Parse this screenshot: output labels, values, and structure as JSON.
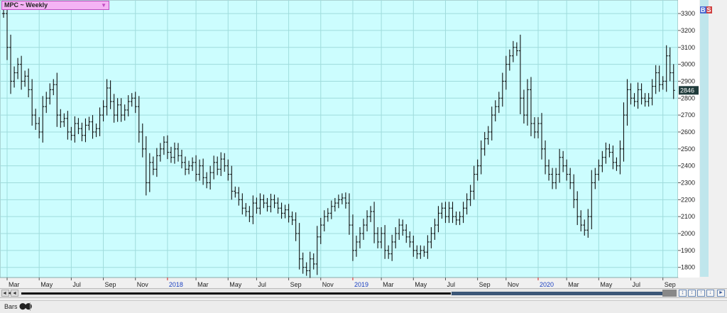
{
  "window": {
    "symbol_title": "MPC ~ Weekly",
    "bs_b": "B",
    "bs_s": "S"
  },
  "statusbar": {
    "view_label": "Bars"
  },
  "chart_data": {
    "type": "ohlc",
    "title": "MPC ~ Weekly",
    "ylim": [
      1740,
      3380
    ],
    "yticks": [
      1800,
      1900,
      2000,
      2100,
      2200,
      2300,
      2400,
      2500,
      2600,
      2700,
      2800,
      2900,
      3000,
      3100,
      3200,
      3300
    ],
    "last_price_label": "2846",
    "x_ticks": [
      {
        "label": "Mar",
        "week": 1,
        "year": false
      },
      {
        "label": "May",
        "week": 10,
        "year": false
      },
      {
        "label": "Jul",
        "week": 19,
        "year": false
      },
      {
        "label": "Sep",
        "week": 28,
        "year": false
      },
      {
        "label": "Nov",
        "week": 37,
        "year": false
      },
      {
        "label": "2018",
        "week": 46,
        "year": true
      },
      {
        "label": "Mar",
        "week": 54,
        "year": false
      },
      {
        "label": "May",
        "week": 63,
        "year": false
      },
      {
        "label": "Jul",
        "week": 71,
        "year": false
      },
      {
        "label": "Sep",
        "week": 80,
        "year": false
      },
      {
        "label": "Nov",
        "week": 89,
        "year": false
      },
      {
        "label": "2019",
        "week": 98,
        "year": true
      },
      {
        "label": "Mar",
        "week": 106,
        "year": false
      },
      {
        "label": "May",
        "week": 115,
        "year": false
      },
      {
        "label": "Jul",
        "week": 124,
        "year": false
      },
      {
        "label": "Sep",
        "week": 133,
        "year": false
      },
      {
        "label": "Nov",
        "week": 141,
        "year": false
      },
      {
        "label": "2020",
        "week": 150,
        "year": true
      },
      {
        "label": "Mar",
        "week": 158,
        "year": false
      },
      {
        "label": "May",
        "week": 167,
        "year": false
      },
      {
        "label": "Jul",
        "week": 176,
        "year": false
      },
      {
        "label": "Sep",
        "week": 185,
        "year": false
      }
    ],
    "closes": [
      3300,
      3100,
      2900,
      2950,
      3000,
      2900,
      2930,
      2850,
      2700,
      2650,
      2600,
      2750,
      2800,
      2850,
      2880,
      2700,
      2660,
      2680,
      2600,
      2580,
      2650,
      2620,
      2580,
      2640,
      2660,
      2600,
      2620,
      2700,
      2750,
      2860,
      2780,
      2700,
      2760,
      2700,
      2730,
      2780,
      2800,
      2750,
      2600,
      2500,
      2300,
      2420,
      2380,
      2460,
      2500,
      2540,
      2480,
      2450,
      2500,
      2460,
      2420,
      2380,
      2400,
      2420,
      2350,
      2400,
      2330,
      2300,
      2360,
      2420,
      2380,
      2440,
      2400,
      2350,
      2250,
      2240,
      2200,
      2150,
      2130,
      2100,
      2180,
      2150,
      2200,
      2180,
      2160,
      2200,
      2180,
      2150,
      2120,
      2140,
      2100,
      2080,
      2000,
      1850,
      1800,
      1780,
      1850,
      1820,
      1980,
      2050,
      2100,
      2120,
      2160,
      2180,
      2200,
      2210,
      2180,
      2050,
      1900,
      1950,
      2000,
      2050,
      2100,
      2130,
      2000,
      1950,
      2000,
      1900,
      1880,
      1950,
      2000,
      2050,
      2020,
      1980,
      1950,
      1900,
      1880,
      1900,
      1890,
      1950,
      2000,
      2050,
      2120,
      2150,
      2100,
      2150,
      2100,
      2080,
      2100,
      2150,
      2200,
      2250,
      2350,
      2400,
      2500,
      2560,
      2600,
      2700,
      2750,
      2800,
      2900,
      3000,
      3050,
      3100,
      3080,
      2800,
      2700,
      2850,
      2650,
      2600,
      2650,
      2500,
      2400,
      2350,
      2300,
      2350,
      2450,
      2400,
      2350,
      2300,
      2200,
      2100,
      2050,
      2020,
      2100,
      2300,
      2350,
      2400,
      2450,
      2500,
      2480,
      2420,
      2400,
      2500,
      2700,
      2850,
      2800,
      2780,
      2850,
      2800,
      2780,
      2800,
      2870,
      2950,
      2880,
      2900,
      3050,
      2950,
      2846
    ]
  }
}
